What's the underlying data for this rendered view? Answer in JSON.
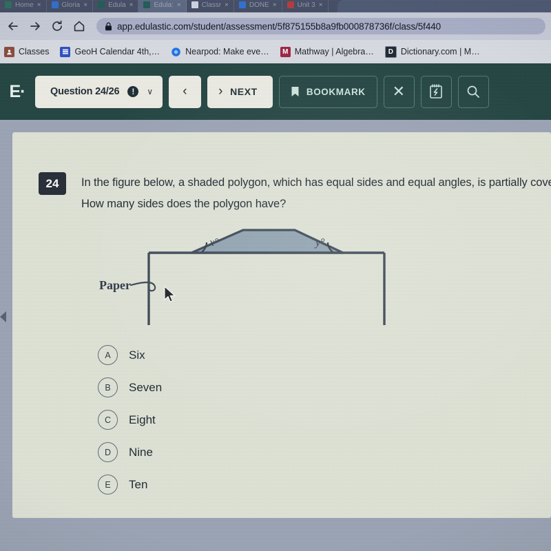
{
  "browser": {
    "tabs": [
      {
        "title": "Home",
        "close": "×",
        "favicon_color": "#2b6f5e",
        "active": false
      },
      {
        "title": "Gloria",
        "close": "×",
        "favicon_color": "#2f6fd0",
        "active": false
      },
      {
        "title": "Edula",
        "close": "×",
        "favicon_color": "#1f5c55",
        "active": false
      },
      {
        "title": "Edula:",
        "close": "×",
        "favicon_color": "#1f5c55",
        "active": true
      },
      {
        "title": "Classr",
        "close": "×",
        "favicon_color": "#cfd4e2",
        "active": false
      },
      {
        "title": "DONE",
        "close": "×",
        "favicon_color": "#2f6fd0",
        "active": false
      },
      {
        "title": "Unit 3",
        "close": "×",
        "favicon_color": "#b03a3a",
        "active": false
      }
    ],
    "nav": {
      "back_icon": "back-arrow-icon",
      "forward_icon": "forward-arrow-icon",
      "reload_icon": "reload-icon",
      "home_icon": "home-icon",
      "lock_icon": "lock-icon",
      "url": "app.edulastic.com/student/assessment/5f875155b8a9fb000878736f/class/5f440"
    },
    "bookmarks": [
      {
        "label": "Classes",
        "icon_color": "#8a4a3c",
        "glyph": "■"
      },
      {
        "label": "GeoH Calendar 4th,…",
        "icon_color": "#2b4fc2",
        "glyph": "☰"
      },
      {
        "label": "Nearpod: Make eve…",
        "icon_color": "#1a73e8",
        "glyph": "●"
      },
      {
        "label": "Mathway | Algebra…",
        "icon_color": "#9b2242",
        "glyph": "M"
      },
      {
        "label": "Dictionary.com | M…",
        "icon_color": "#1b2430",
        "glyph": "D"
      }
    ]
  },
  "app": {
    "brand": "E·",
    "question_label": "Question 24/26",
    "warning_glyph": "!",
    "chevron_glyph": "∨",
    "prev_label": "‹",
    "next_label": "NEXT",
    "next_arrow": "›",
    "bookmark_label": "BOOKMARK",
    "close_label": "✕",
    "toolbar_icons": {
      "bookmark": "bookmark-flag-icon",
      "close": "close-x-icon",
      "scratchpad": "scratchpad-notepad-icon",
      "zoom": "magnifier-zoom-icon"
    }
  },
  "question": {
    "number": "24",
    "text": "In the figure below, a shaded polygon, which has equal sides and equal angles, is partially covered. How many sides does the polygon have?",
    "figure": {
      "paper_label": "Paper",
      "angle_labels": [
        "x°",
        "y°"
      ],
      "shade_color": "#8fa3b0",
      "stroke_color": "#3a4654"
    },
    "choices": [
      {
        "key": "A",
        "text": "Six"
      },
      {
        "key": "B",
        "text": "Seven"
      },
      {
        "key": "C",
        "text": "Eight"
      },
      {
        "key": "D",
        "text": "Nine"
      },
      {
        "key": "E",
        "text": "Ten"
      }
    ]
  },
  "colors": {
    "toolbar_green": "#214340",
    "card_bg": "#dfe3d6",
    "page_bg": "#9aa3b4",
    "badge_dark": "#242b36"
  }
}
